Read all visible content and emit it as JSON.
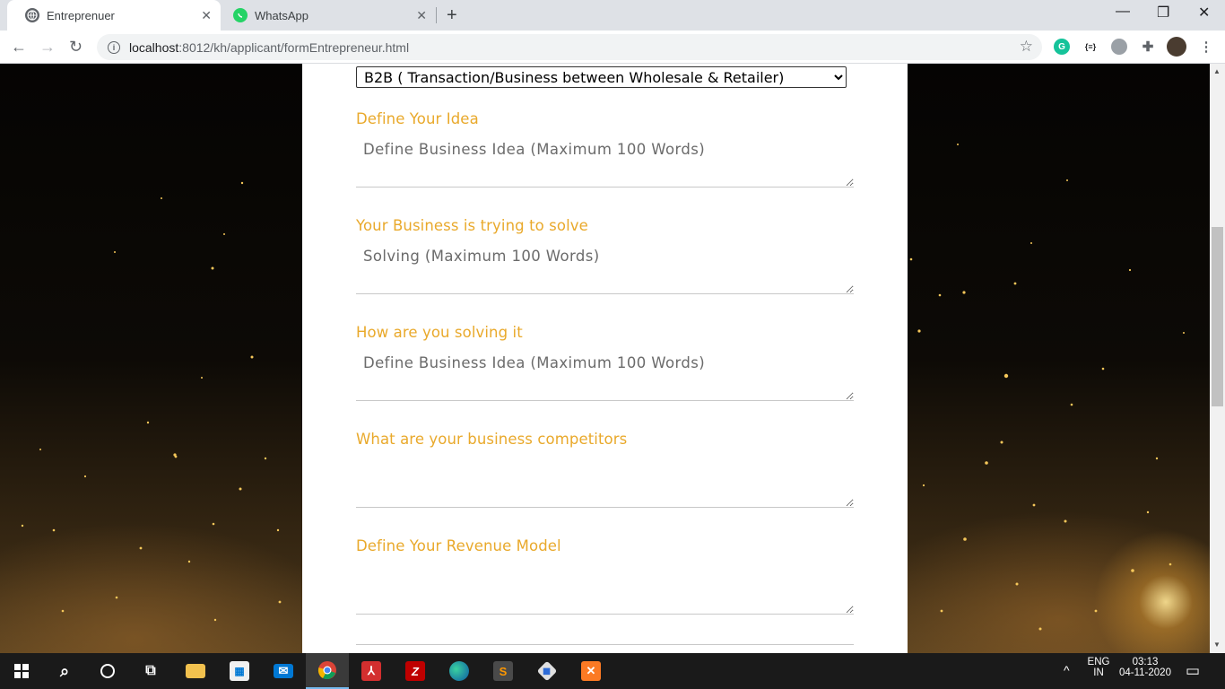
{
  "browser": {
    "tabs": [
      {
        "title": "Entreprenuer",
        "icon": "globe-icon",
        "active": true
      },
      {
        "title": "WhatsApp",
        "icon": "whatsapp-icon",
        "active": false
      }
    ],
    "address": "localhost:8012/kh/applicant/formEntrepreneur.html",
    "address_host": "localhost",
    "address_rest": ":8012/kh/applicant/formEntrepreneur.html"
  },
  "form": {
    "category_selected": "B2B ( Transaction/Business between Wholesale & Retailer)",
    "fields": [
      {
        "label": "Define Your Idea",
        "placeholder": "Define Business Idea (Maximum 100 Words)"
      },
      {
        "label": "Your Business is trying to solve",
        "placeholder": "Solving (Maximum 100 Words)"
      },
      {
        "label": "How are you solving it",
        "placeholder": "Define Business Idea (Maximum 100 Words)"
      },
      {
        "label": "What are your business competitors",
        "placeholder": ""
      },
      {
        "label": "Define Your Revenue Model",
        "placeholder": ""
      }
    ]
  },
  "taskbar": {
    "language": "ENG",
    "region": "IN",
    "time": "03:13",
    "date": "04-11-2020"
  },
  "colors": {
    "label_gold": "#e9a92b",
    "taskbar": "#1a1a1a",
    "tab_strip": "#dee1e6"
  }
}
